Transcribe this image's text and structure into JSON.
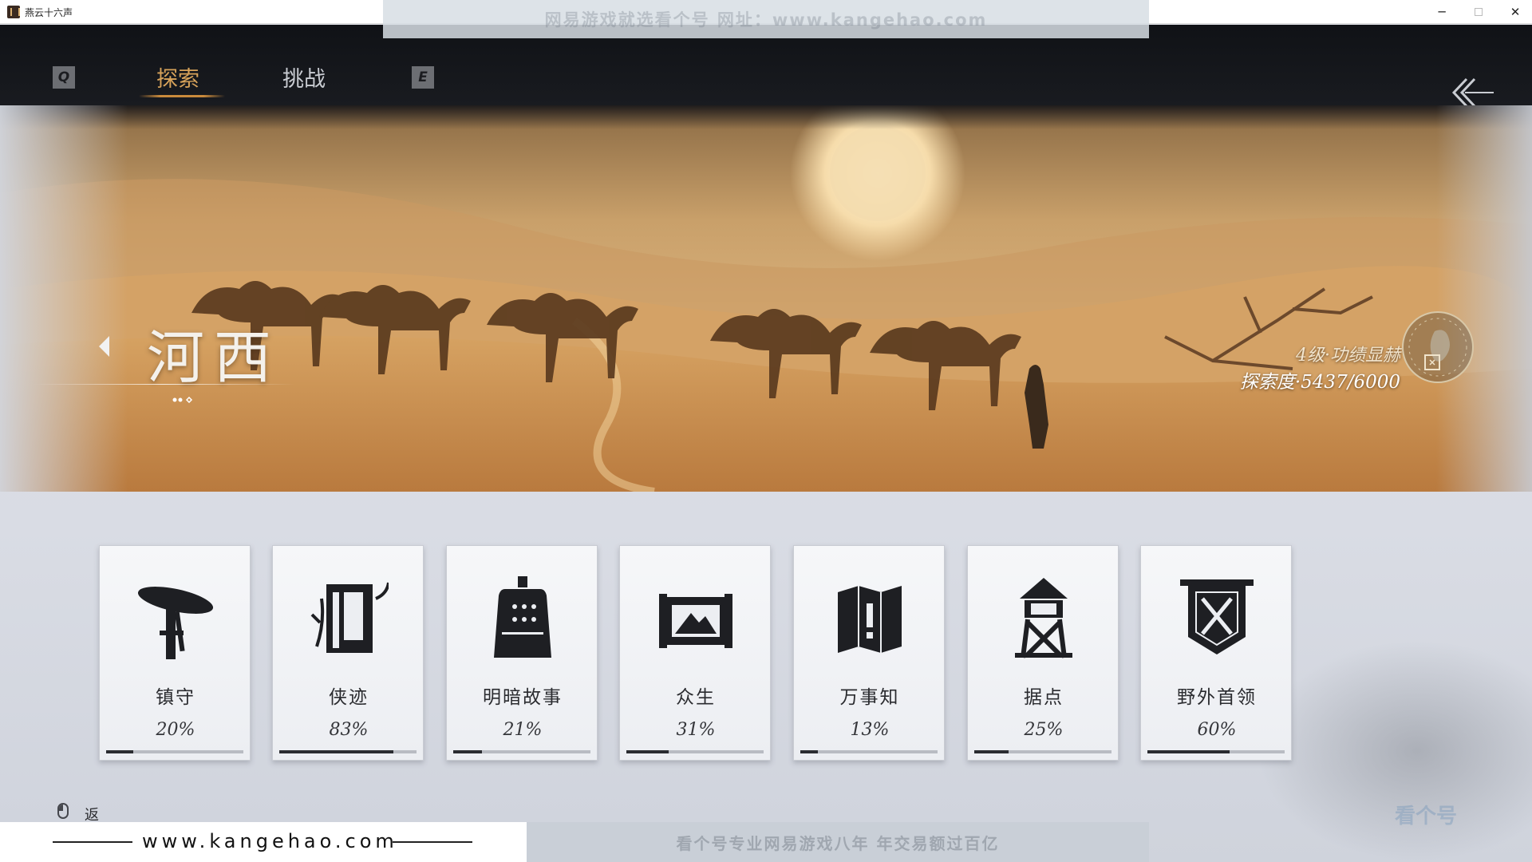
{
  "window": {
    "title": "燕云十六声",
    "minimize": "─",
    "close": "✕"
  },
  "watermark": {
    "top": "网易游戏就选看个号   网址：www.kangehao.com",
    "site": "www.kangehao.com",
    "bottom": "看个号专业网易游戏八年   年交易额过百亿",
    "logo": "看个号"
  },
  "tabs": {
    "prev_key": "Q",
    "next_key": "E",
    "items": [
      {
        "label": "探索",
        "active": true
      },
      {
        "label": "挑战",
        "active": false
      }
    ]
  },
  "region": {
    "name": "河西",
    "level": "4级·功绩显赫",
    "progress": "探索度·5437/6000"
  },
  "categories": [
    {
      "label": "镇守",
      "percent": "20%",
      "progress": 0.2,
      "icon": "hat-sword-icon"
    },
    {
      "label": "侠迹",
      "percent": "83%",
      "progress": 0.83,
      "icon": "book-icon"
    },
    {
      "label": "明暗故事",
      "percent": "21%",
      "progress": 0.21,
      "icon": "bell-icon"
    },
    {
      "label": "众生",
      "percent": "31%",
      "progress": 0.31,
      "icon": "scroll-mountain-icon"
    },
    {
      "label": "万事知",
      "percent": "13%",
      "progress": 0.13,
      "icon": "map-question-icon"
    },
    {
      "label": "据点",
      "percent": "25%",
      "progress": 0.25,
      "icon": "watchtower-icon"
    },
    {
      "label": "野外首领",
      "percent": "60%",
      "progress": 0.6,
      "icon": "crossed-swords-banner-icon"
    }
  ],
  "footer": {
    "back_label": "返回"
  }
}
